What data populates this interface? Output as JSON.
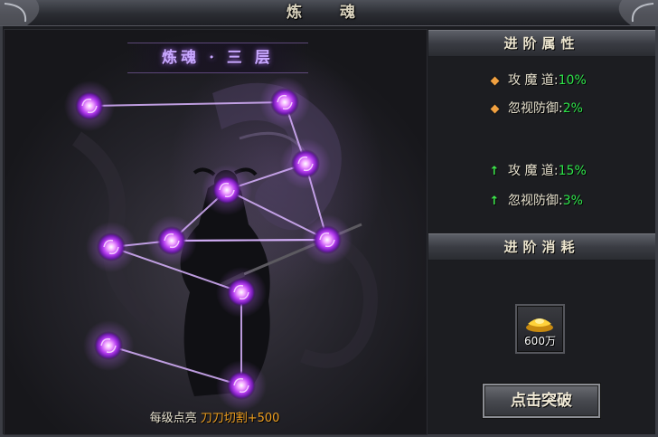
{
  "window": {
    "title": "炼 魂"
  },
  "soul_panel": {
    "layer_title": "炼魂 · 三 层",
    "footer_prefix": "每级点亮",
    "footer_bonus": "刀刀切割+500",
    "nodes_lit": 11
  },
  "advance_attributes": {
    "header": "进阶属性",
    "current": [
      {
        "label": "攻 魔 道:",
        "value": "10%",
        "icon": "orange-diamond-icon"
      },
      {
        "label": "忽视防御:",
        "value": "2%",
        "icon": "orange-diamond-icon"
      }
    ],
    "next": [
      {
        "label": "攻 魔 道:",
        "value": "15%",
        "icon": "green-up-arrow-icon"
      },
      {
        "label": "忽视防御:",
        "value": "3%",
        "icon": "green-up-arrow-icon"
      }
    ]
  },
  "advance_cost": {
    "header": "进阶消耗",
    "item": {
      "icon": "gold-ingot-icon",
      "quantity": "600万"
    }
  },
  "actions": {
    "breakthrough_label": "点击突破"
  },
  "colors": {
    "accent_purple": "#b070ff",
    "value_green": "#2ee64a",
    "bonus_orange": "#f0a020"
  }
}
